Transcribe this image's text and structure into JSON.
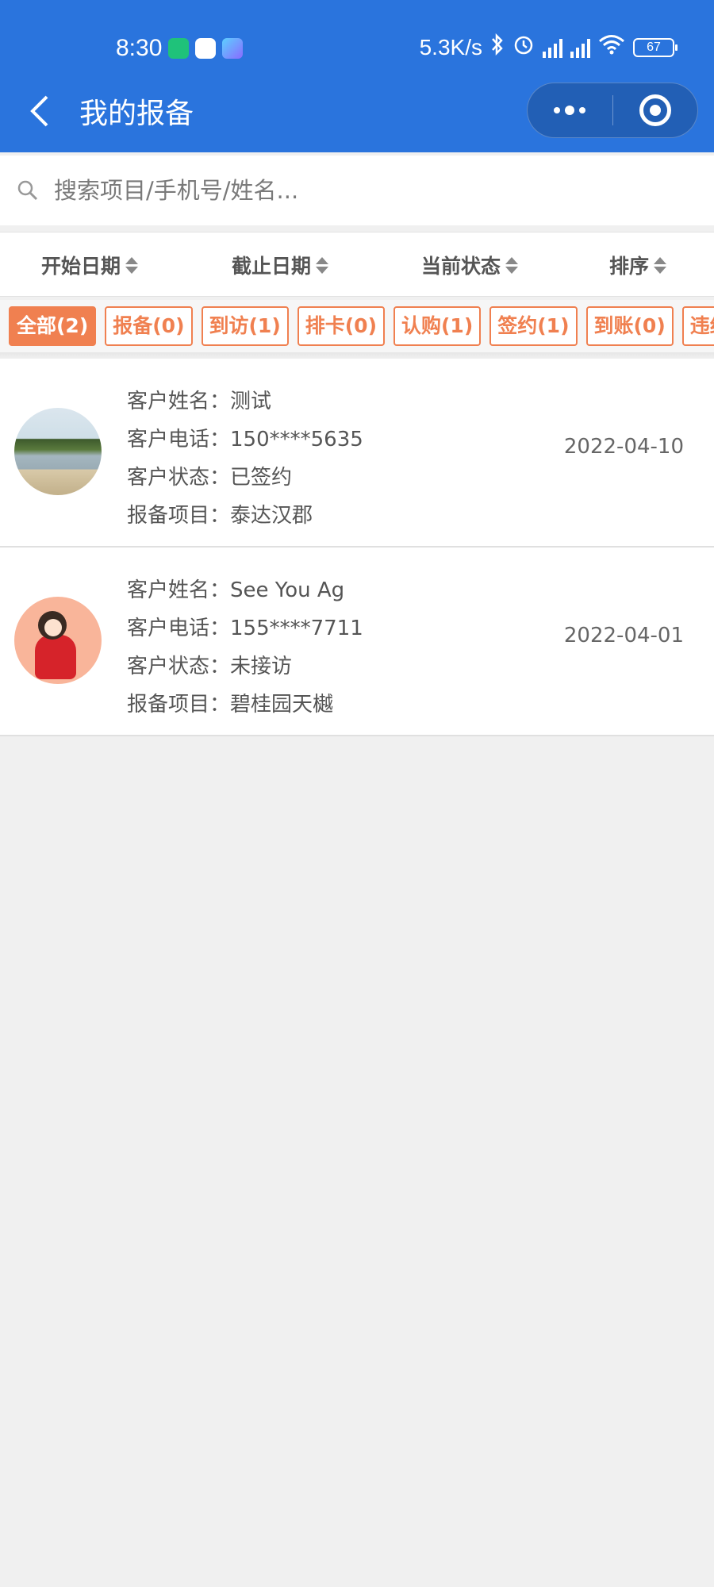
{
  "status_bar": {
    "time": "8:30",
    "speed": "5.3K/s",
    "battery": "67",
    "icons": [
      "shield-app-icon",
      "baidu-icon",
      "app-icon",
      "bluetooth-icon",
      "alarm-icon",
      "signal-icon",
      "signal-icon",
      "wifi-icon",
      "battery-icon"
    ]
  },
  "nav": {
    "title": "我的报备"
  },
  "search": {
    "placeholder": "搜索项目/手机号/姓名..."
  },
  "filters": [
    {
      "label": "开始日期"
    },
    {
      "label": "截止日期"
    },
    {
      "label": "当前状态"
    },
    {
      "label": "排序"
    }
  ],
  "tabs": [
    "全部(2)",
    "报备(0)",
    "到访(1)",
    "排卡(0)",
    "认购(1)",
    "签约(1)",
    "到账(0)",
    "违约"
  ],
  "active_tab": 0,
  "colors": {
    "header": "#2a74dd",
    "accent": "#f08050"
  },
  "records": [
    {
      "name_label": "客户姓名：",
      "name": "测试",
      "phone_label": "客户电话：",
      "phone": "150****5635",
      "status_label": "客户状态：",
      "status": "已签约",
      "project_label": "报备项目：",
      "project": "泰达汉郡",
      "date": "2022-04-10",
      "avatar": "scenic-photo"
    },
    {
      "name_label": "客户姓名：",
      "name": "See You Ag",
      "phone_label": "客户电话：",
      "phone": "155****7711",
      "status_label": "客户状态：",
      "status": "未接访",
      "project_label": "报备项目：",
      "project": "碧桂园天樾",
      "date": "2022-04-01",
      "avatar": "cartoon-character"
    }
  ]
}
